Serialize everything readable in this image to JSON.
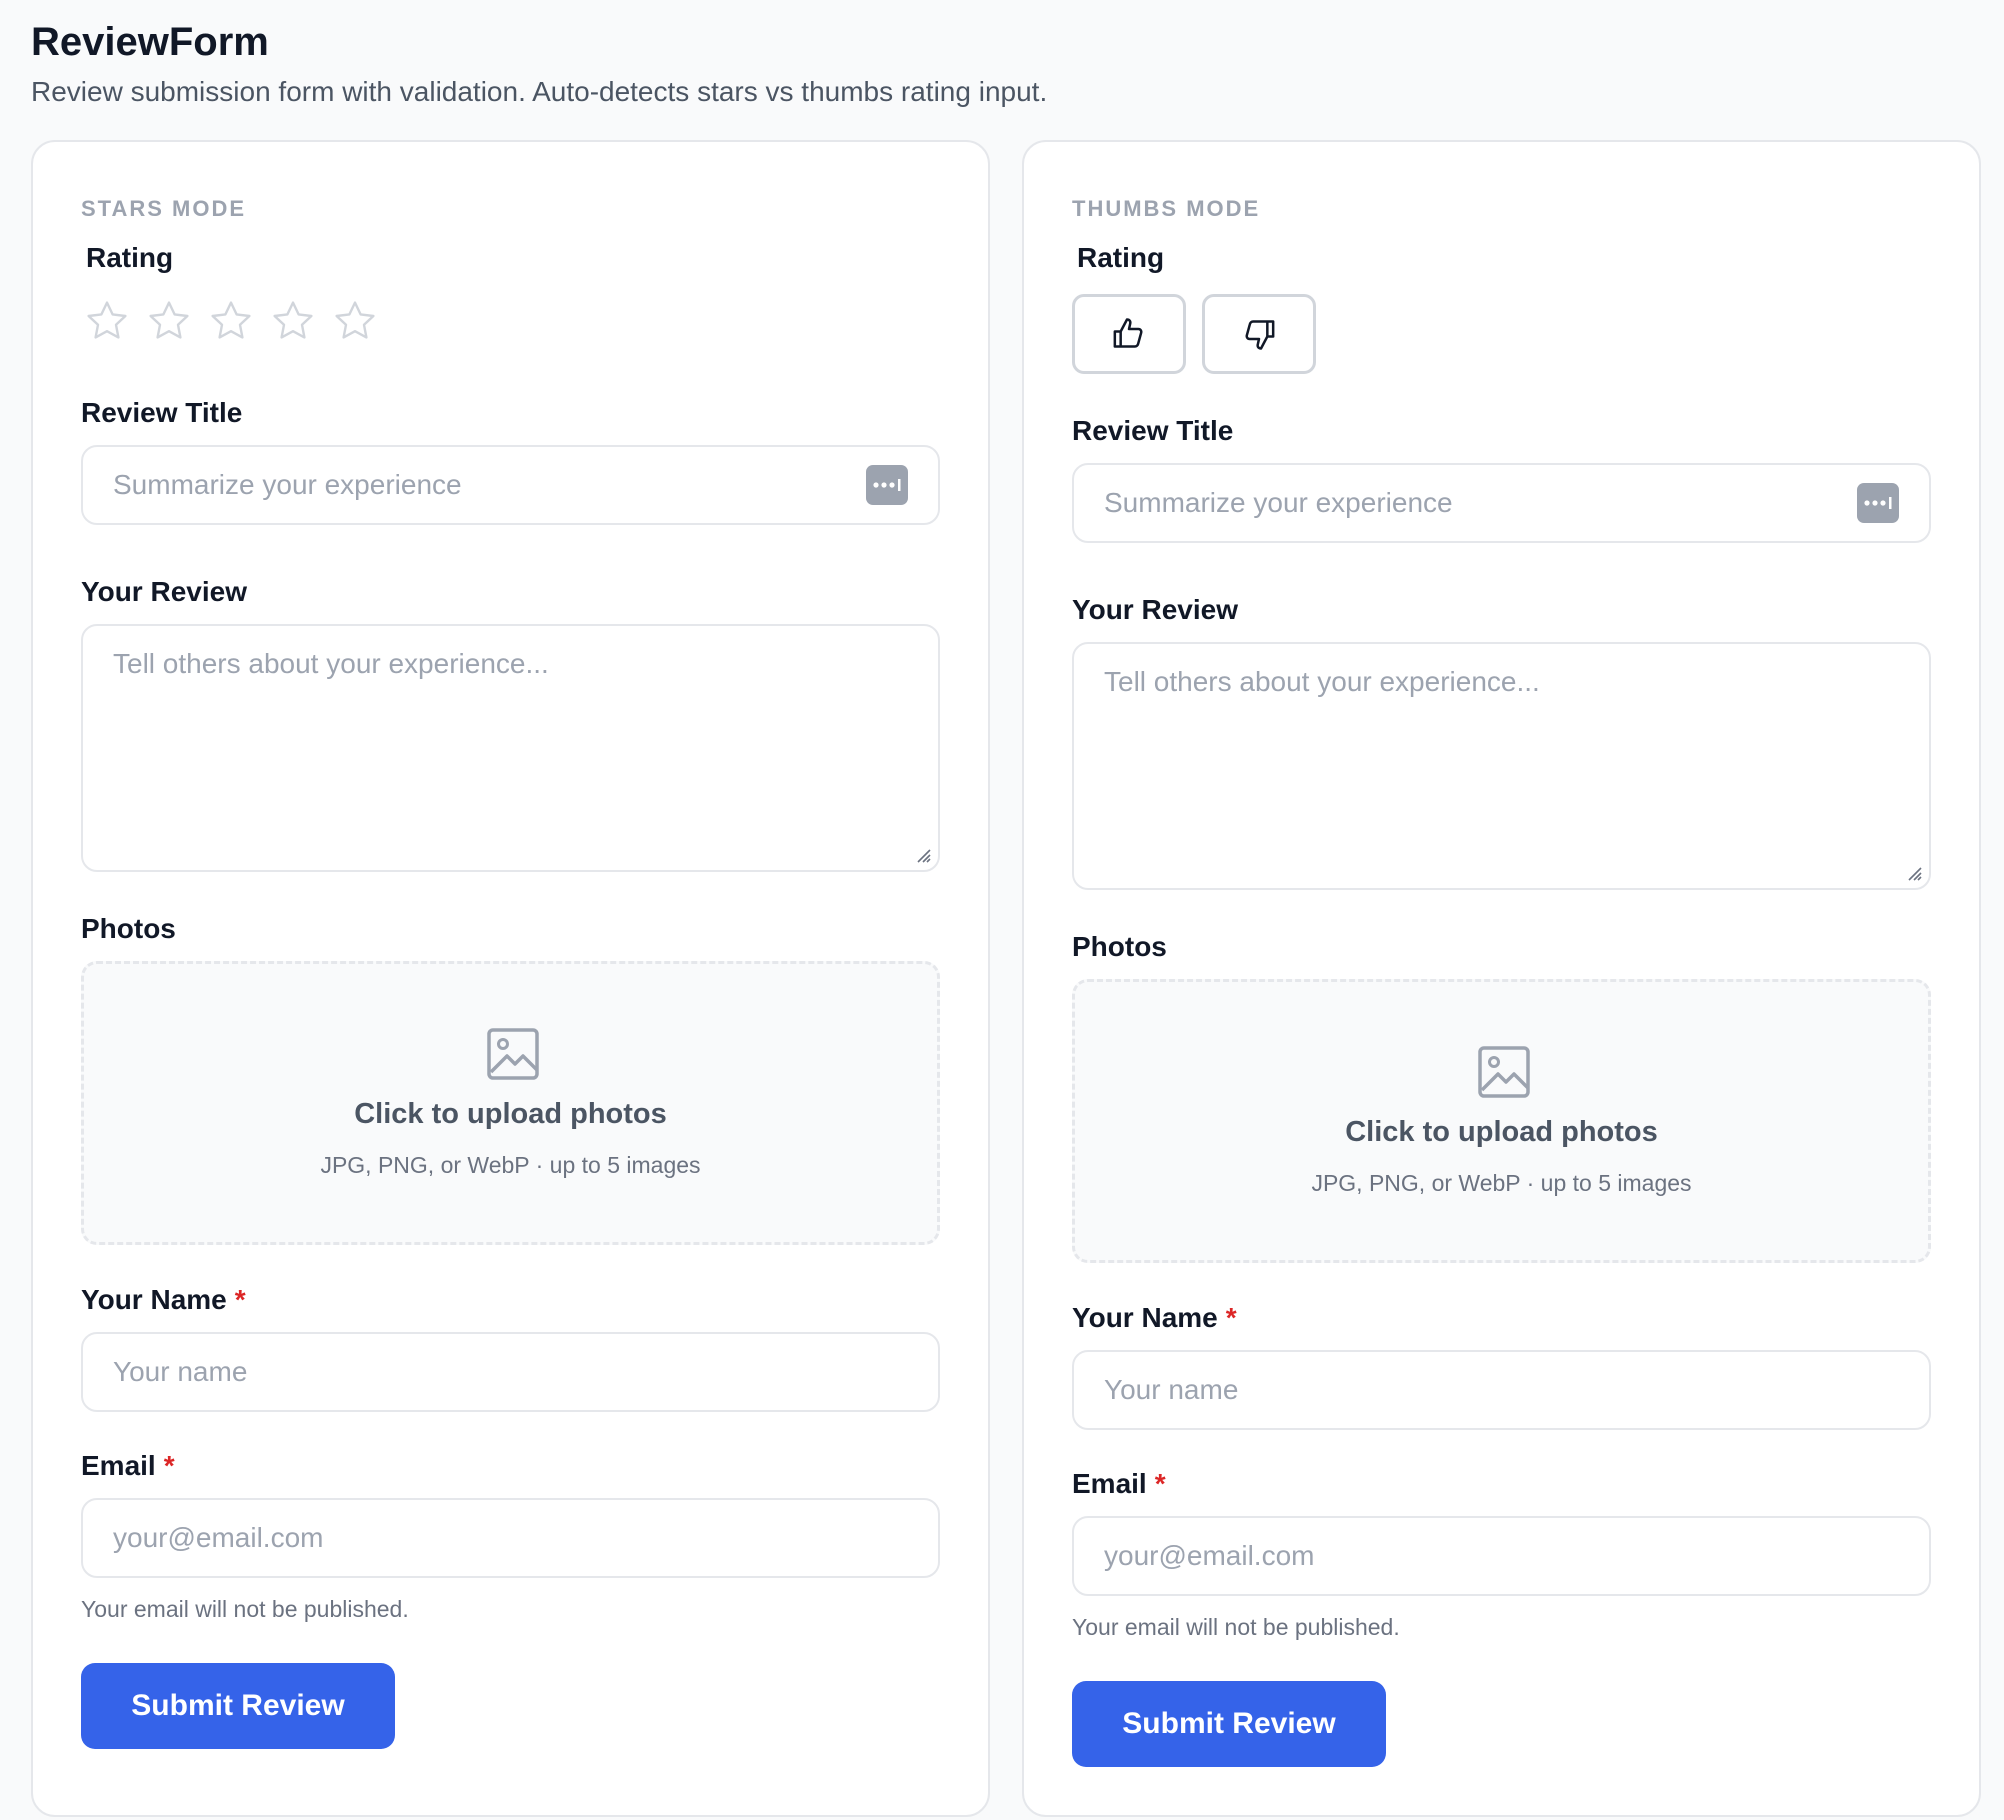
{
  "page": {
    "title": "ReviewForm",
    "subtitle": "Review submission form with validation. Auto-detects stars vs thumbs rating input."
  },
  "stars_card": {
    "mode_label": "STARS MODE",
    "rating_label": "Rating",
    "rating_value": 0,
    "rating_max": 5,
    "title_label": "Review Title",
    "title_placeholder": "Summarize your experience",
    "review_label": "Your Review",
    "review_placeholder": "Tell others about your experience...",
    "photos_label": "Photos",
    "upload_title": "Click to upload photos",
    "upload_hint": "JPG, PNG, or WebP · up to 5 images",
    "name_label": "Your Name",
    "name_placeholder": "Your name",
    "required_mark": "*",
    "email_label": "Email",
    "email_placeholder": "your@email.com",
    "email_help": "Your email will not be published.",
    "submit_label": "Submit Review"
  },
  "thumbs_card": {
    "mode_label": "THUMBS MODE",
    "rating_label": "Rating",
    "thumbs_up_icon": "thumbs-up-icon",
    "thumbs_down_icon": "thumbs-down-icon",
    "title_label": "Review Title",
    "title_placeholder": "Summarize your experience",
    "review_label": "Your Review",
    "review_placeholder": "Tell others about your experience...",
    "photos_label": "Photos",
    "upload_title": "Click to upload photos",
    "upload_hint": "JPG, PNG, or WebP · up to 5 images",
    "name_label": "Your Name",
    "name_placeholder": "Your name",
    "required_mark": "*",
    "email_label": "Email",
    "email_placeholder": "your@email.com",
    "email_help": "Your email will not be published.",
    "submit_label": "Submit Review"
  },
  "colors": {
    "accent": "#3563e9",
    "required": "#dc2626",
    "border": "#e5e7eb",
    "placeholder": "#9ca3af"
  }
}
